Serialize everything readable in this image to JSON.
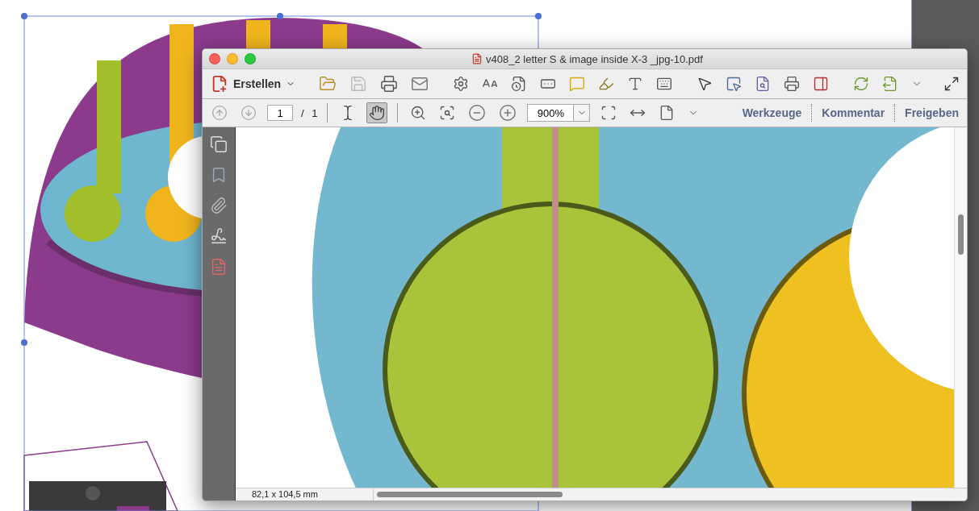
{
  "window": {
    "title": "v408_2 letter S & image inside X-3 _jpg-10.pdf"
  },
  "toolbar": {
    "create_button": {
      "label": "Erstellen"
    }
  },
  "navigation": {
    "page_number": "1",
    "page_count": "/ 1",
    "zoom": "900%"
  },
  "tools": [
    {
      "kind": "select",
      "selected": false
    },
    {
      "kind": "hand",
      "selected": true
    }
  ],
  "panel_tabs": [
    {
      "label": "Werkzeuge"
    },
    {
      "label": "Kommentar"
    },
    {
      "label": "Freigeben"
    }
  ],
  "status_bar": {
    "page_size": "82,1 x 104,5 mm"
  }
}
